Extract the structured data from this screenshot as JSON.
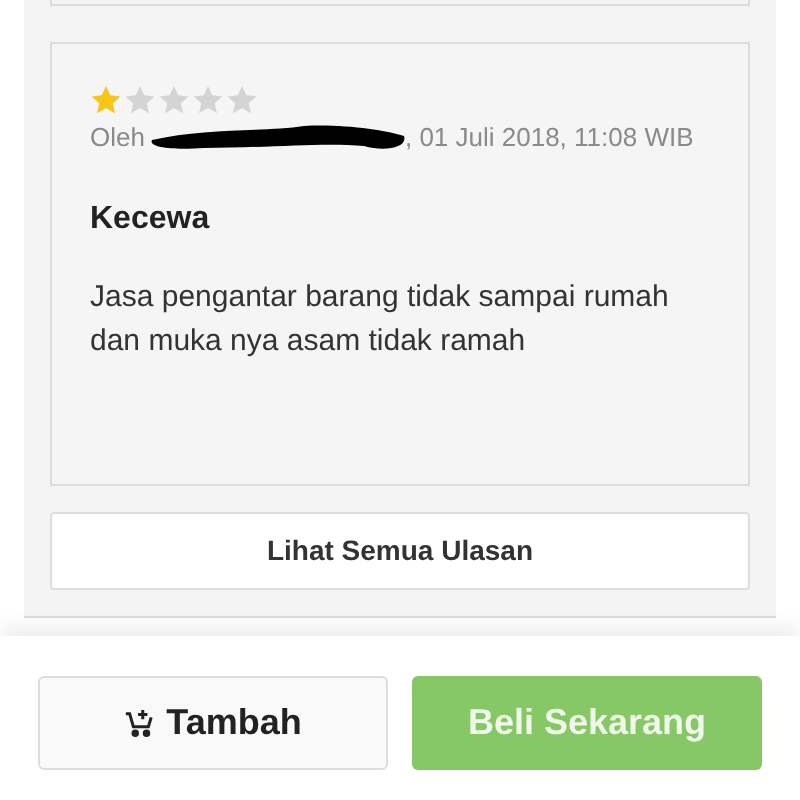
{
  "review": {
    "stars": 1,
    "author_prefix": "Oleh",
    "date": ", 01 Juli 2018, 11:08 WIB",
    "title": "Kecewa",
    "body": "Jasa pengantar barang tidak sampai rumah dan muka nya asam tidak ramah"
  },
  "see_all_button": "Lihat Semua Ulasan",
  "bottom_bar": {
    "add_button": "Tambah",
    "buy_button": "Beli Sekarang"
  }
}
